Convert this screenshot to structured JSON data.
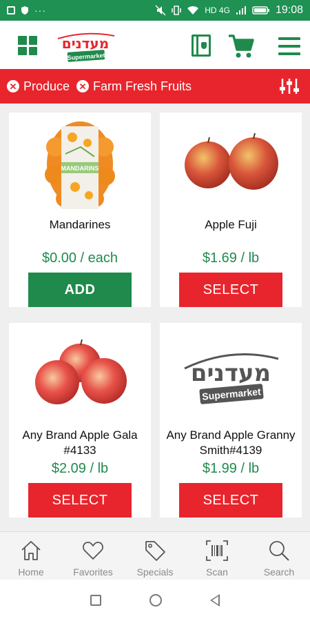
{
  "status_bar": {
    "network": "HD 4G",
    "time": "19:08",
    "icons": [
      "image-icon",
      "shield-icon",
      "more-dots-icon",
      "mute-icon",
      "vibrate-icon",
      "wifi-icon",
      "signal-icon",
      "battery-icon"
    ]
  },
  "app_bar": {
    "logo_hebrew": "מעדנים",
    "logo_sub": "Supermarket",
    "icons": [
      "grid-menu-icon",
      "book-icon",
      "cart-icon",
      "hamburger-icon"
    ],
    "brand_green": "#1f8a4c",
    "brand_red": "#e8252d"
  },
  "filters": {
    "chips": [
      {
        "label": "Produce"
      },
      {
        "label": "Farm Fresh Fruits"
      }
    ],
    "remove_icon": "close-circle-icon",
    "sort_icon": "sliders-icon"
  },
  "products": [
    {
      "name": "Mandarines",
      "price": "$0.00 / each",
      "action": "ADD"
    },
    {
      "name": "Apple Fuji",
      "price": "$1.69 / lb",
      "action": "SELECT"
    },
    {
      "name": "Any Brand Apple Gala #4133",
      "price": "$2.09 / lb",
      "action": "SELECT"
    },
    {
      "name": "Any Brand Apple Granny Smith#4139",
      "price": "$1.99 / lb",
      "action": "SELECT"
    }
  ],
  "placeholder_logo": {
    "hebrew": "מעדנים",
    "sub": "Supermarket"
  },
  "mandarine_bag_label": "MANDARINS",
  "tabs": [
    {
      "label": "Home",
      "icon": "home-icon"
    },
    {
      "label": "Favorites",
      "icon": "heart-icon"
    },
    {
      "label": "Specials",
      "icon": "tag-icon"
    },
    {
      "label": "Scan",
      "icon": "barcode-icon"
    },
    {
      "label": "Search",
      "icon": "search-icon"
    }
  ],
  "system_nav": [
    "recents-icon",
    "home-circle-icon",
    "back-icon"
  ]
}
